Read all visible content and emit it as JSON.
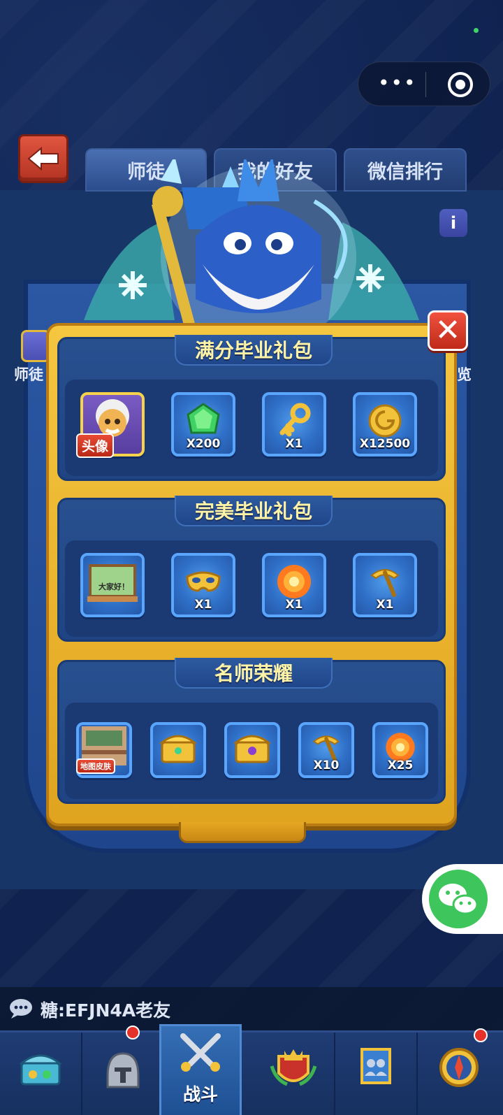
{
  "tabs": [
    {
      "label": "师徒",
      "active": true
    },
    {
      "label": "我的好友",
      "active": false
    },
    {
      "label": "微信排行",
      "active": false
    }
  ],
  "side": {
    "left_label": "师徒",
    "right_label": "览"
  },
  "dialog": {
    "sections": [
      {
        "title": "满分毕业礼包",
        "items": [
          {
            "icon": "avatar-icon",
            "tag": "头像",
            "qty": ""
          },
          {
            "icon": "gem-icon",
            "qty": "X200"
          },
          {
            "icon": "key-icon",
            "qty": "X1"
          },
          {
            "icon": "coin-icon",
            "qty": "X12500"
          }
        ]
      },
      {
        "title": "完美毕业礼包",
        "items": [
          {
            "icon": "blackboard-icon",
            "board_text": "大家好！",
            "qty": ""
          },
          {
            "icon": "mask-icon",
            "qty": "X1"
          },
          {
            "icon": "fire-orb-icon",
            "qty": "X1"
          },
          {
            "icon": "pickaxe-icon",
            "qty": "X1"
          }
        ]
      },
      {
        "title": "名师荣耀",
        "items": [
          {
            "icon": "map-skin-icon",
            "tag": "地图皮肤",
            "qty": ""
          },
          {
            "icon": "chest-gold-icon",
            "qty": ""
          },
          {
            "icon": "chest-purple-icon",
            "qty": ""
          },
          {
            "icon": "pickaxe-icon",
            "qty": "X10"
          },
          {
            "icon": "fire-orb-icon",
            "qty": "X25"
          }
        ]
      }
    ]
  },
  "chat": {
    "text": "糖:EFJN4A老友"
  },
  "bottom_nav": [
    {
      "icon": "treasure-chest-icon",
      "label": "",
      "badge": false
    },
    {
      "icon": "knight-helmet-icon",
      "label": "",
      "badge": true
    },
    {
      "icon": "crossed-swords-icon",
      "label": "战斗",
      "badge": false,
      "active": true
    },
    {
      "icon": "crown-shield-icon",
      "label": "",
      "badge": false
    },
    {
      "icon": "guild-banner-icon",
      "label": "",
      "badge": false
    },
    {
      "icon": "compass-icon",
      "label": "",
      "badge": true
    }
  ],
  "colors": {
    "background": "#0f2250",
    "dialog_gold": "#f5c640",
    "section_blue": "#28508f",
    "title_yellow": "#fff3a6",
    "close_red": "#e0402e",
    "wechat_green": "#3ec65c"
  }
}
